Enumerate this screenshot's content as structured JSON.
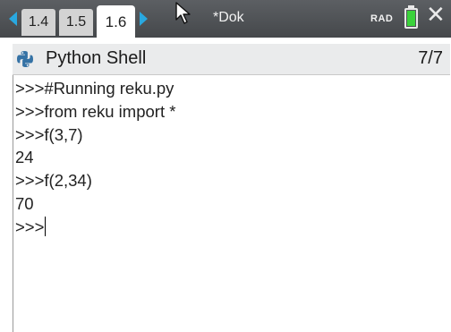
{
  "topbar": {
    "tabs": [
      {
        "label": "1.4",
        "active": false
      },
      {
        "label": "1.5",
        "active": false
      },
      {
        "label": "1.6",
        "active": true
      }
    ],
    "document_title": "*Dok",
    "angle_mode": "RAD",
    "battery_color": "#3bd23b",
    "accent_color": "#29a8e0",
    "icons": [
      "nav-left-arrow",
      "nav-right-arrow",
      "mouse-pointer",
      "battery",
      "close-x"
    ]
  },
  "app": {
    "title": "Python Shell",
    "page_count": "7/7",
    "icon": "python-logo"
  },
  "shell": {
    "lines": [
      ">>>#Running reku.py",
      ">>>from reku import *",
      ">>>f(3,7)",
      "24",
      ">>>f(2,34)",
      "70"
    ],
    "prompt": ">>>"
  }
}
